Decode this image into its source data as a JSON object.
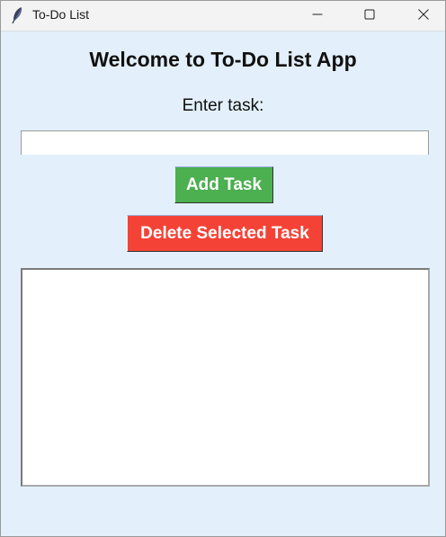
{
  "window": {
    "title": "To-Do List",
    "icon": "feather-icon",
    "controls": {
      "minimize": "minimize-icon",
      "maximize": "maximize-icon",
      "close": "close-icon"
    }
  },
  "main": {
    "heading": "Welcome to To-Do List App",
    "input_label": "Enter task:",
    "task_input": {
      "value": "",
      "placeholder": ""
    },
    "add_button_label": "Add Task",
    "delete_button_label": "Delete Selected Task",
    "tasks": []
  },
  "colors": {
    "background": "#e3f0fb",
    "add_button": "#4caf50",
    "delete_button": "#f44336",
    "button_text": "#ffffff"
  }
}
